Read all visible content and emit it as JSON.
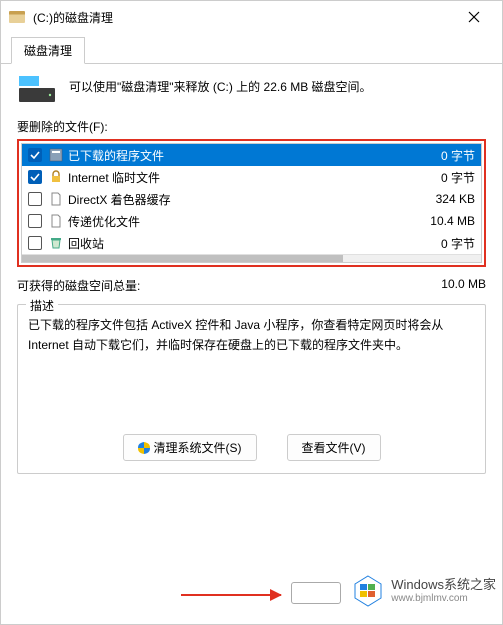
{
  "window": {
    "title": "(C:)的磁盘清理"
  },
  "tab": {
    "label": "磁盘清理"
  },
  "info": "可以使用\"磁盘清理\"来释放  (C:) 上的 22.6 MB 磁盘空间。",
  "filesLabel": "要删除的文件(F):",
  "files": {
    "items": [
      {
        "checked": true,
        "name": "已下载的程序文件",
        "size": "0 字节",
        "selected": true,
        "icon": "app"
      },
      {
        "checked": true,
        "name": "Internet 临时文件",
        "size": "0 字节",
        "selected": false,
        "icon": "lock"
      },
      {
        "checked": false,
        "name": "DirectX 着色器缓存",
        "size": "324 KB",
        "selected": false,
        "icon": "doc"
      },
      {
        "checked": false,
        "name": "传递优化文件",
        "size": "10.4 MB",
        "selected": false,
        "icon": "doc"
      },
      {
        "checked": false,
        "name": "回收站",
        "size": "0 字节",
        "selected": false,
        "icon": "bin"
      }
    ]
  },
  "total": {
    "label": "可获得的磁盘空间总量:",
    "value": "10.0 MB"
  },
  "desc": {
    "legend": "描述",
    "text": "已下载的程序文件包括 ActiveX 控件和 Java 小程序，你查看特定网页时将会从 Internet 自动下载它们，并临时保存在硬盘上的已下载的程序文件夹中。"
  },
  "buttons": {
    "cleanSystem": "清理系统文件(S)",
    "viewFiles": "查看文件(V)"
  },
  "watermark": {
    "main": "Windows系统之家",
    "sub": "www.bjmlmv.com"
  }
}
